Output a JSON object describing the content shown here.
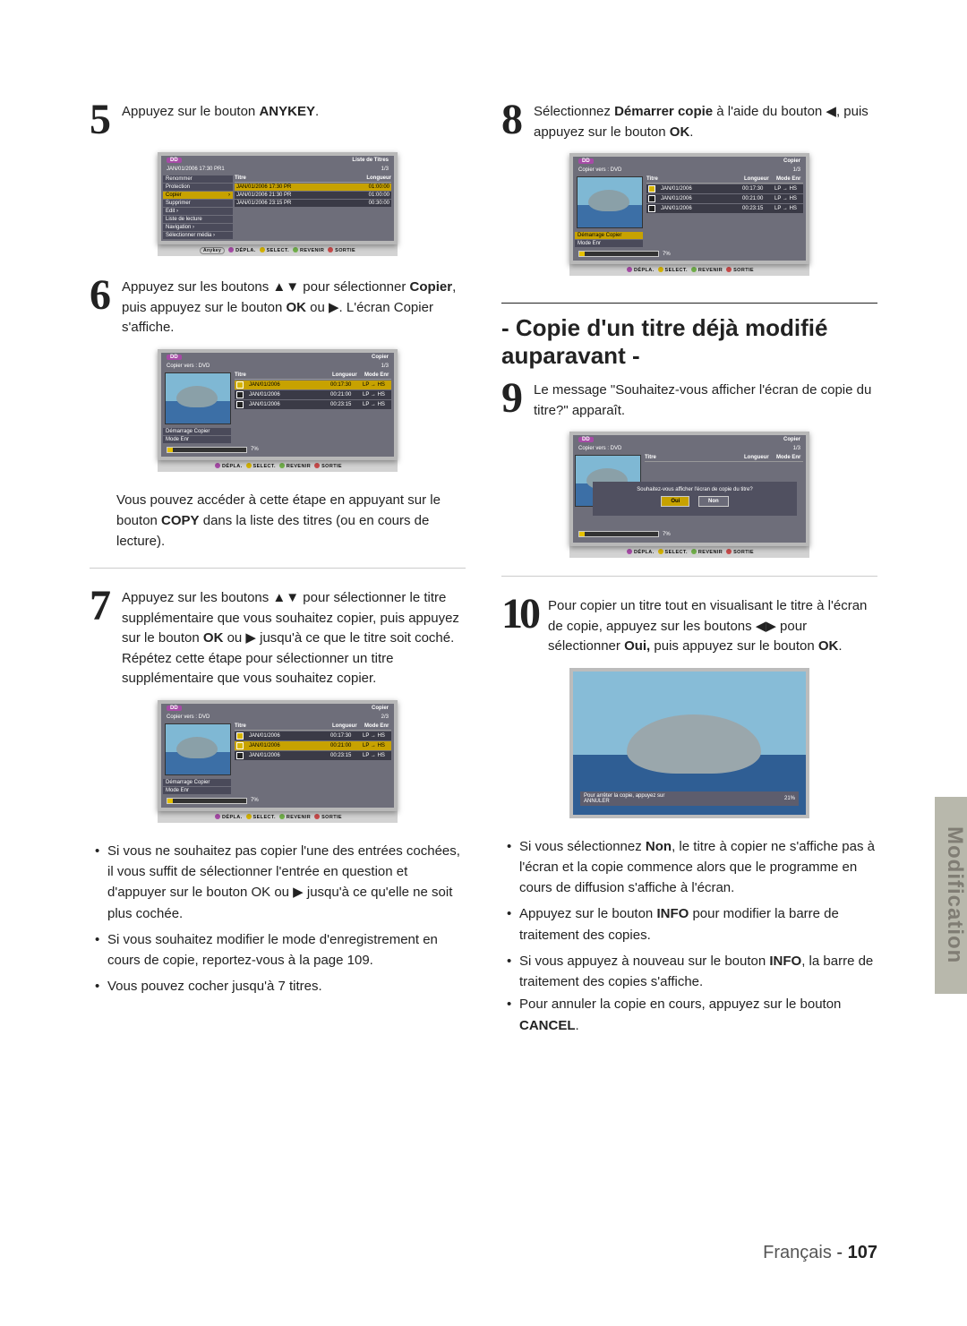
{
  "sideTab": "Modification",
  "footer": {
    "lang": "Français",
    "page": "107"
  },
  "sectionTitle": "- Copie d'un titre déjà modifié auparavant -",
  "steps": {
    "s5": "Appuyez sur le bouton <b>ANYKEY</b>.",
    "s6": "Appuyez sur les boutons ▲▼ pour sélectionner <b>Copier</b>, puis appuyez sur le bouton <b>OK</b> ou ▶. L'écran Copier s'affiche.",
    "s6note": "Vous pouvez accéder à cette étape en appuyant sur le bouton <b>COPY</b> dans la liste des titres (ou en cours de lecture).",
    "s7": "Appuyez sur les boutons ▲▼ pour sélectionner le titre supplémentaire que vous souhaitez copier, puis appuyez sur le bouton <b>OK</b> ou ▶ jusqu'à ce que le titre soit coché. Répétez cette étape pour sélectionner un titre supplémentaire que vous souhaitez copier.",
    "s7bullets": [
      "Si vous ne souhaitez pas copier l'une des entrées cochées, il vous suffit de sélectionner l'entrée en question et d'appuyer sur le bouton OK ou ▶ jusqu'à ce qu'elle ne soit plus cochée.",
      "Si vous souhaitez modifier le mode d'enregistrement en cours de copie, reportez-vous à la page 109.",
      "Vous pouvez cocher jusqu'à 7 titres."
    ],
    "s8": "Sélectionnez <b>Démarrer copie</b> à l'aide du bouton ◀, puis appuyez sur le bouton <b>OK</b>.",
    "s9": "Le message \"Souhaitez-vous afficher l'écran de copie du titre?\" apparaît.",
    "s10": "Pour copier un titre tout en visualisant le titre à l'écran de copie, appuyez sur les boutons ◀▶ pour sélectionner <b>Oui,</b> puis appuyez sur le bouton <b>OK</b>.",
    "s10bullets": [
      "Si vous sélectionnez <b>Non</b>, le titre à copier ne s'affiche pas à l'écran et la copie commence alors que le programme en cours de diffusion s'affiche à l'écran.",
      "Appuyez sur le bouton <b>INFO</b> pour modifier la barre de traitement des copies.",
      "Si vous appuyez à nouveau sur le bouton <b>INFO</b>, la barre de traitement des copies s'affiche.",
      "Pour annuler la copie en cours, appuyez sur le bouton <b>CANCEL</b>."
    ]
  },
  "osd": {
    "hddBadge": "DD",
    "footer": "DÉPLA.   SELECT.   REVENIR   SORTIE",
    "anykey": {
      "ttl": "Liste de Titres",
      "sub": "JAN/01/2006 17:30 PR1",
      "page": "1/3",
      "menu": [
        "Renommer",
        "Protection",
        "Copier",
        "Supprimer",
        "Edit            ›",
        "Liste de lecture",
        "Navigation      ›",
        "Sélectionner média ›"
      ],
      "listHead": [
        "Titre",
        "Longueur"
      ],
      "rows": [
        [
          "JAN/01/2006 17:30 PR",
          "01:00:00"
        ],
        [
          "JAN/01/2006 21:30 PR",
          "01:00:00"
        ],
        [
          "JAN/01/2006 23:15 PR",
          "00:30:00"
        ]
      ]
    },
    "copier": {
      "ttl": "Copier",
      "sub": "Copier vers : DVD",
      "page13": "1/3",
      "page23": "2/3",
      "menu": [
        "Démarrage Copier",
        "Mode Enr"
      ],
      "listHead": [
        "Titre",
        "Longueur",
        "Mode Enr"
      ],
      "rows": [
        {
          "t": "JAN/01/2006",
          "len": "00:17:30",
          "m": "LP → HS"
        },
        {
          "t": "JAN/01/2006",
          "len": "00:21:00",
          "m": "LP → HS"
        },
        {
          "t": "JAN/01/2006",
          "len": "00:23:15",
          "m": "LP → HS"
        }
      ],
      "progress": "7%",
      "progress21": "21%",
      "prompt": "Souhaitez-vous afficher l'écran de copie du titre?",
      "yes": "Oui",
      "no": "Non",
      "stopMsg": "Pour arrêter la copie, appuyez sur ANNULER"
    }
  }
}
